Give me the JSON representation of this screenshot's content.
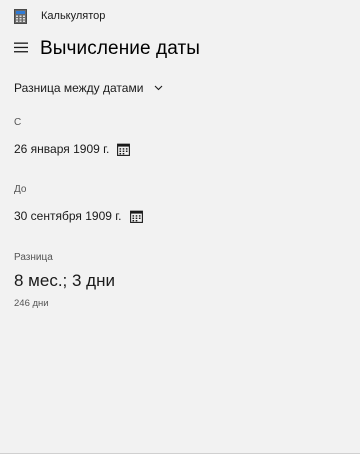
{
  "app": {
    "title": "Калькулятор"
  },
  "header": {
    "page_title": "Вычисление даты"
  },
  "mode": {
    "selected": "Разница между датами"
  },
  "from": {
    "label": "С",
    "value": "26 января 1909 г."
  },
  "to": {
    "label": "До",
    "value": "30 сентября 1909 г."
  },
  "result": {
    "label": "Разница",
    "value": "8 мес.; 3 дни",
    "days": "246 дни"
  },
  "icons": {
    "app": "calculator-icon",
    "menu": "hamburger-menu-icon",
    "dropdown": "chevron-down-icon",
    "calendar": "calendar-icon"
  },
  "colors": {
    "background": "#f2f2f2",
    "text": "#1a1a1a",
    "secondary_text": "#555555"
  }
}
